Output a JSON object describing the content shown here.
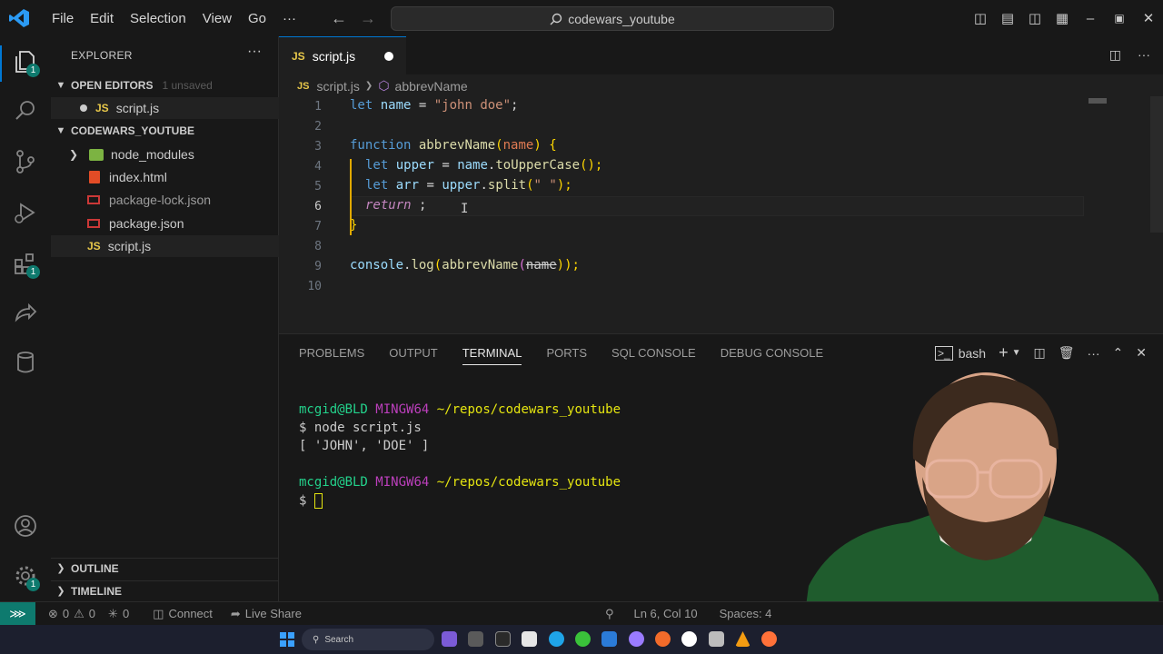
{
  "titlebar": {
    "menu": [
      "File",
      "Edit",
      "Selection",
      "View",
      "Go",
      "···"
    ],
    "search_text": "codewars_youtube"
  },
  "activity": {
    "explorer_badge": "1",
    "extensions_badge": "1",
    "manage_badge": "1"
  },
  "sidebar": {
    "title": "EXPLORER",
    "more": "···",
    "open_editors": {
      "label": "OPEN EDITORS",
      "unsaved": "1 unsaved",
      "items": [
        {
          "icon": "JS",
          "name": "script.js"
        }
      ]
    },
    "workspace": {
      "label": "CODEWARS_YOUTUBE",
      "items": [
        {
          "name": "node_modules"
        },
        {
          "name": "index.html"
        },
        {
          "name": "package-lock.json"
        },
        {
          "name": "package.json"
        },
        {
          "icon": "JS",
          "name": "script.js"
        }
      ]
    },
    "outline": "OUTLINE",
    "timeline": "TIMELINE"
  },
  "editor": {
    "tab": {
      "icon": "JS",
      "name": "script.js"
    },
    "breadcrumb": {
      "file": "script.js",
      "symbol": "abbrevName"
    },
    "line_numbers": [
      "1",
      "2",
      "3",
      "4",
      "5",
      "6",
      "7",
      "8",
      "9",
      "10"
    ],
    "current_line": "6",
    "code": {
      "l1_kw": "let",
      "l1_var": "name",
      "l1_eq": " = ",
      "l1_str": "\"john doe\"",
      "l1_end": ";",
      "l3_kw": "function",
      "l3_fn": "abbrevName",
      "l3_open": "(",
      "l3_arg": "name",
      "l3_close": ")",
      "l3_brace": " {",
      "l4_kw": "let",
      "l4_var": "upper",
      "l4_eq": " = ",
      "l4_obj": "name",
      "l4_dot": ".",
      "l4_fn": "toUpperCase",
      "l4_end": "();",
      "l5_kw": "let",
      "l5_var": "arr",
      "l5_eq": " = ",
      "l5_obj": "upper",
      "l5_dot": ".",
      "l5_fn": "split",
      "l5_open": "(",
      "l5_str": "\" \"",
      "l5_end": ");",
      "l6_kw": "return",
      "l6_end": " ;",
      "l7_brace": "}",
      "l9_obj": "console",
      "l9_dot": ".",
      "l9_fn": "log",
      "l9_open": "(",
      "l9_fn2": "abbrevName",
      "l9_open2": "(",
      "l9_arg": "name",
      "l9_end": "));"
    }
  },
  "panel": {
    "tabs": [
      "PROBLEMS",
      "OUTPUT",
      "TERMINAL",
      "PORTS",
      "SQL CONSOLE",
      "DEBUG CONSOLE"
    ],
    "active_tab": "TERMINAL",
    "shell": "bash",
    "terminal": {
      "p1_user": "mcgid@BLD",
      "p1_sys": "MINGW64",
      "p1_path": "~/repos/codewars_youtube",
      "cmd": "$ node script.js",
      "out": "[ 'JOHN', 'DOE' ]",
      "p2_user": "mcgid@BLD",
      "p2_sys": "MINGW64",
      "p2_path": "~/repos/codewars_youtube",
      "prompt": "$ "
    }
  },
  "statusbar": {
    "errors": "0",
    "warnings": "0",
    "ports": "0",
    "connect": "Connect",
    "live_share": "Live Share",
    "position": "Ln 6, Col 10",
    "spaces": "Spaces: 4"
  },
  "taskbar": {
    "search": "Search"
  }
}
